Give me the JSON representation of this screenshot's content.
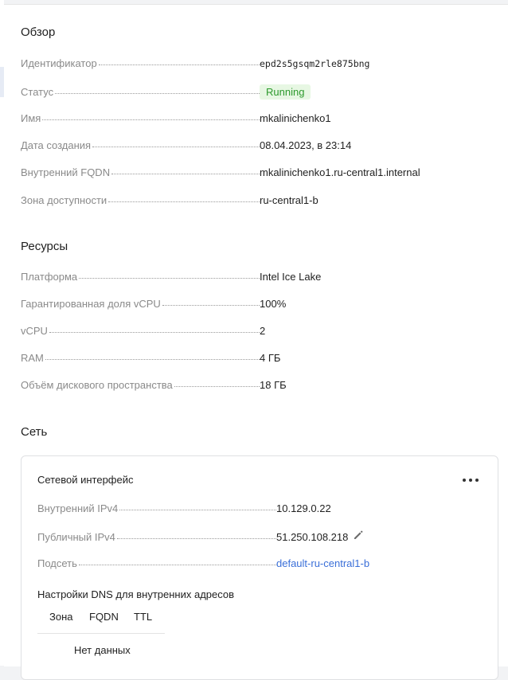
{
  "overview": {
    "title": "Обзор",
    "rows": [
      {
        "label": "Идентификатор",
        "value": "epd2s5gsqm2rle875bng"
      },
      {
        "label": "Статус",
        "value": "Running"
      },
      {
        "label": "Имя",
        "value": "mkalinichenko1"
      },
      {
        "label": "Дата создания",
        "value": "08.04.2023, в 23:14"
      },
      {
        "label": "Внутренний FQDN",
        "value": "mkalinichenko1.ru-central1.internal"
      },
      {
        "label": "Зона доступности",
        "value": "ru-central1-b"
      }
    ]
  },
  "resources": {
    "title": "Ресурсы",
    "rows": [
      {
        "label": "Платформа",
        "value": "Intel Ice Lake"
      },
      {
        "label": "Гарантированная доля vCPU",
        "value": "100%"
      },
      {
        "label": "vCPU",
        "value": "2"
      },
      {
        "label": "RAM",
        "value": "4 ГБ"
      },
      {
        "label": "Объём дискового пространства",
        "value": "18 ГБ"
      }
    ]
  },
  "network": {
    "title": "Сеть",
    "card": {
      "title": "Сетевой интерфейс",
      "more_icon": "more-horizontal-icon",
      "rows": [
        {
          "label": "Внутренний IPv4",
          "value": "10.129.0.22"
        },
        {
          "label": "Публичный IPv4",
          "value": "51.250.108.218"
        },
        {
          "label": "Подсеть",
          "value": "default-ru-central1-b"
        }
      ],
      "edit_icon": "pencil-icon",
      "dns": {
        "title": "Настройки DNS для внутренних адресов",
        "columns": [
          "Зона",
          "FQDN",
          "TTL"
        ],
        "empty_text": "Нет данных"
      }
    }
  },
  "colors": {
    "status_bg": "#e7f7e3",
    "status_text": "#2d9a2d",
    "link": "#3a6fd8",
    "label": "#8a8a8a"
  }
}
